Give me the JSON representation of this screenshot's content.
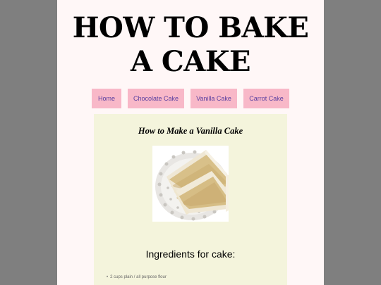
{
  "header": {
    "title_line1": "HOW TO BAKE",
    "title_line2": "A CAKE"
  },
  "nav": {
    "items": [
      {
        "label": "Home"
      },
      {
        "label": "Chocolate Cake"
      },
      {
        "label": "Vanilla Cake"
      },
      {
        "label": "Carrot Cake"
      }
    ]
  },
  "article": {
    "title": "How to Make a Vanilla Cake",
    "ingredients_heading": "Ingredients for cake:",
    "ingredients": [
      "2 cups plain / all purpose flour"
    ]
  },
  "colors": {
    "backdrop": "#7f7f7f",
    "page_background": "#fff7f7",
    "nav_button": "#f8b8c8",
    "nav_text": "#5a3fa0",
    "content_background": "#f4f4dc"
  }
}
